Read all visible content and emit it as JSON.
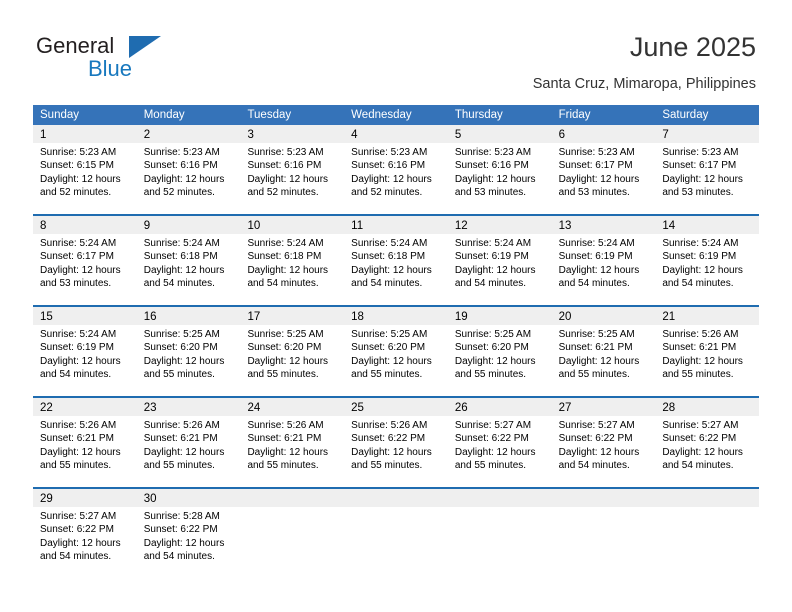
{
  "brand": {
    "name_part1": "General",
    "name_part2": "Blue",
    "accent_color": "#1f6cb0"
  },
  "header": {
    "title": "June 2025",
    "subtitle": "Santa Cruz, Mimaropa, Philippines"
  },
  "calendar": {
    "header_bg": "#3573b9",
    "daynum_bg": "#efefef",
    "weekday_headers": [
      "Sunday",
      "Monday",
      "Tuesday",
      "Wednesday",
      "Thursday",
      "Friday",
      "Saturday"
    ],
    "weeks": [
      {
        "days": [
          {
            "num": "1",
            "sunrise": "Sunrise: 5:23 AM",
            "sunset": "Sunset: 6:15 PM",
            "daylight": "Daylight: 12 hours and 52 minutes."
          },
          {
            "num": "2",
            "sunrise": "Sunrise: 5:23 AM",
            "sunset": "Sunset: 6:16 PM",
            "daylight": "Daylight: 12 hours and 52 minutes."
          },
          {
            "num": "3",
            "sunrise": "Sunrise: 5:23 AM",
            "sunset": "Sunset: 6:16 PM",
            "daylight": "Daylight: 12 hours and 52 minutes."
          },
          {
            "num": "4",
            "sunrise": "Sunrise: 5:23 AM",
            "sunset": "Sunset: 6:16 PM",
            "daylight": "Daylight: 12 hours and 52 minutes."
          },
          {
            "num": "5",
            "sunrise": "Sunrise: 5:23 AM",
            "sunset": "Sunset: 6:16 PM",
            "daylight": "Daylight: 12 hours and 53 minutes."
          },
          {
            "num": "6",
            "sunrise": "Sunrise: 5:23 AM",
            "sunset": "Sunset: 6:17 PM",
            "daylight": "Daylight: 12 hours and 53 minutes."
          },
          {
            "num": "7",
            "sunrise": "Sunrise: 5:23 AM",
            "sunset": "Sunset: 6:17 PM",
            "daylight": "Daylight: 12 hours and 53 minutes."
          }
        ]
      },
      {
        "days": [
          {
            "num": "8",
            "sunrise": "Sunrise: 5:24 AM",
            "sunset": "Sunset: 6:17 PM",
            "daylight": "Daylight: 12 hours and 53 minutes."
          },
          {
            "num": "9",
            "sunrise": "Sunrise: 5:24 AM",
            "sunset": "Sunset: 6:18 PM",
            "daylight": "Daylight: 12 hours and 54 minutes."
          },
          {
            "num": "10",
            "sunrise": "Sunrise: 5:24 AM",
            "sunset": "Sunset: 6:18 PM",
            "daylight": "Daylight: 12 hours and 54 minutes."
          },
          {
            "num": "11",
            "sunrise": "Sunrise: 5:24 AM",
            "sunset": "Sunset: 6:18 PM",
            "daylight": "Daylight: 12 hours and 54 minutes."
          },
          {
            "num": "12",
            "sunrise": "Sunrise: 5:24 AM",
            "sunset": "Sunset: 6:19 PM",
            "daylight": "Daylight: 12 hours and 54 minutes."
          },
          {
            "num": "13",
            "sunrise": "Sunrise: 5:24 AM",
            "sunset": "Sunset: 6:19 PM",
            "daylight": "Daylight: 12 hours and 54 minutes."
          },
          {
            "num": "14",
            "sunrise": "Sunrise: 5:24 AM",
            "sunset": "Sunset: 6:19 PM",
            "daylight": "Daylight: 12 hours and 54 minutes."
          }
        ]
      },
      {
        "days": [
          {
            "num": "15",
            "sunrise": "Sunrise: 5:24 AM",
            "sunset": "Sunset: 6:19 PM",
            "daylight": "Daylight: 12 hours and 54 minutes."
          },
          {
            "num": "16",
            "sunrise": "Sunrise: 5:25 AM",
            "sunset": "Sunset: 6:20 PM",
            "daylight": "Daylight: 12 hours and 55 minutes."
          },
          {
            "num": "17",
            "sunrise": "Sunrise: 5:25 AM",
            "sunset": "Sunset: 6:20 PM",
            "daylight": "Daylight: 12 hours and 55 minutes."
          },
          {
            "num": "18",
            "sunrise": "Sunrise: 5:25 AM",
            "sunset": "Sunset: 6:20 PM",
            "daylight": "Daylight: 12 hours and 55 minutes."
          },
          {
            "num": "19",
            "sunrise": "Sunrise: 5:25 AM",
            "sunset": "Sunset: 6:20 PM",
            "daylight": "Daylight: 12 hours and 55 minutes."
          },
          {
            "num": "20",
            "sunrise": "Sunrise: 5:25 AM",
            "sunset": "Sunset: 6:21 PM",
            "daylight": "Daylight: 12 hours and 55 minutes."
          },
          {
            "num": "21",
            "sunrise": "Sunrise: 5:26 AM",
            "sunset": "Sunset: 6:21 PM",
            "daylight": "Daylight: 12 hours and 55 minutes."
          }
        ]
      },
      {
        "days": [
          {
            "num": "22",
            "sunrise": "Sunrise: 5:26 AM",
            "sunset": "Sunset: 6:21 PM",
            "daylight": "Daylight: 12 hours and 55 minutes."
          },
          {
            "num": "23",
            "sunrise": "Sunrise: 5:26 AM",
            "sunset": "Sunset: 6:21 PM",
            "daylight": "Daylight: 12 hours and 55 minutes."
          },
          {
            "num": "24",
            "sunrise": "Sunrise: 5:26 AM",
            "sunset": "Sunset: 6:21 PM",
            "daylight": "Daylight: 12 hours and 55 minutes."
          },
          {
            "num": "25",
            "sunrise": "Sunrise: 5:26 AM",
            "sunset": "Sunset: 6:22 PM",
            "daylight": "Daylight: 12 hours and 55 minutes."
          },
          {
            "num": "26",
            "sunrise": "Sunrise: 5:27 AM",
            "sunset": "Sunset: 6:22 PM",
            "daylight": "Daylight: 12 hours and 55 minutes."
          },
          {
            "num": "27",
            "sunrise": "Sunrise: 5:27 AM",
            "sunset": "Sunset: 6:22 PM",
            "daylight": "Daylight: 12 hours and 54 minutes."
          },
          {
            "num": "28",
            "sunrise": "Sunrise: 5:27 AM",
            "sunset": "Sunset: 6:22 PM",
            "daylight": "Daylight: 12 hours and 54 minutes."
          }
        ]
      },
      {
        "days": [
          {
            "num": "29",
            "sunrise": "Sunrise: 5:27 AM",
            "sunset": "Sunset: 6:22 PM",
            "daylight": "Daylight: 12 hours and 54 minutes."
          },
          {
            "num": "30",
            "sunrise": "Sunrise: 5:28 AM",
            "sunset": "Sunset: 6:22 PM",
            "daylight": "Daylight: 12 hours and 54 minutes."
          },
          {
            "num": "",
            "sunrise": "",
            "sunset": "",
            "daylight": ""
          },
          {
            "num": "",
            "sunrise": "",
            "sunset": "",
            "daylight": ""
          },
          {
            "num": "",
            "sunrise": "",
            "sunset": "",
            "daylight": ""
          },
          {
            "num": "",
            "sunrise": "",
            "sunset": "",
            "daylight": ""
          },
          {
            "num": "",
            "sunrise": "",
            "sunset": "",
            "daylight": ""
          }
        ]
      }
    ]
  }
}
